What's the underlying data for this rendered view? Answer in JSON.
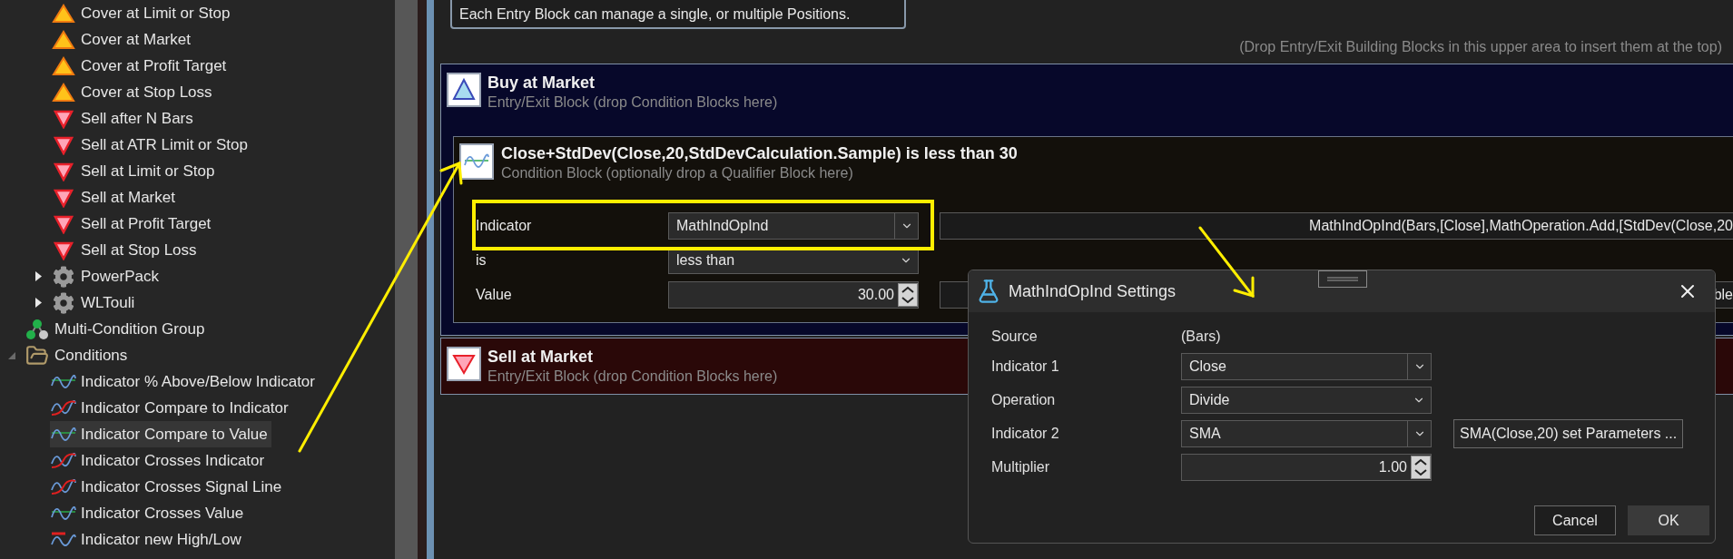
{
  "tree": {
    "continued_children": [
      {
        "label": "Cover at Limit or Stop",
        "kind": "cover",
        "selected": false
      },
      {
        "label": "Cover at Market",
        "kind": "cover",
        "selected": false
      },
      {
        "label": "Cover at Profit Target",
        "kind": "cover",
        "selected": false
      },
      {
        "label": "Cover at Stop Loss",
        "kind": "cover",
        "selected": false
      },
      {
        "label": "Sell after N Bars",
        "kind": "sell",
        "selected": false
      },
      {
        "label": "Sell at ATR Limit or Stop",
        "kind": "sell",
        "selected": false
      },
      {
        "label": "Sell at Limit or Stop",
        "kind": "sell",
        "selected": false
      },
      {
        "label": "Sell at Market",
        "kind": "sell",
        "selected": false
      },
      {
        "label": "Sell at Profit Target",
        "kind": "sell",
        "selected": false
      },
      {
        "label": "Sell at Stop Loss",
        "kind": "sell",
        "selected": false
      },
      {
        "label": "PowerPack",
        "kind": "gear",
        "selected": false,
        "expanded": false
      },
      {
        "label": "WLTouli",
        "kind": "gear",
        "selected": false,
        "expanded": false
      }
    ],
    "items": [
      {
        "label": "Multi-Condition Group",
        "kind": "group",
        "selected": false
      },
      {
        "label": "Conditions",
        "kind": "folder",
        "selected": false,
        "expanded": true,
        "children": [
          {
            "label": "Indicator % Above/Below Indicator",
            "kind": "wave",
            "selected": false
          },
          {
            "label": "Indicator Compare to Indicator",
            "kind": "cross",
            "selected": false
          },
          {
            "label": "Indicator Compare to Value",
            "kind": "wave",
            "selected": true
          },
          {
            "label": "Indicator Crosses Indicator",
            "kind": "cross",
            "selected": false
          },
          {
            "label": "Indicator Crosses Signal Line",
            "kind": "cross",
            "selected": false
          },
          {
            "label": "Indicator Crosses Value",
            "kind": "wave",
            "selected": false
          },
          {
            "label": "Indicator new High/Low",
            "kind": "newhighlow",
            "selected": false
          }
        ]
      }
    ]
  },
  "info_box": "Each Entry Block can manage a single, or multiple Positions.",
  "drop_hint": "(Drop Entry/Exit Building Blocks in this upper area to insert them at the top)",
  "blocks": [
    {
      "kind": "buy",
      "title": "Buy at Market",
      "subtitle": "Entry/Exit Block (drop Condition Blocks here)",
      "conditions": [
        {
          "title": "Close+StdDev(Close,20,StdDevCalculation.Sample) is less than 30",
          "subtitle": "Condition Block (optionally drop a Qualifier Block here)",
          "params": [
            {
              "label": "Indicator",
              "kind": "combo",
              "value": "MathIndOpInd",
              "extra": "MathIndOpInd(Bars,[Close],MathOperation.Add,[StdDev(Close,20"
            },
            {
              "label": "is",
              "kind": "select",
              "value": "less than"
            },
            {
              "label": "Value",
              "kind": "spinner",
              "value": "30.00",
              "extra": "ble"
            }
          ]
        }
      ]
    },
    {
      "kind": "sell",
      "title": "Sell at Market",
      "subtitle": "Entry/Exit Block (drop Condition Blocks here)"
    }
  ],
  "dialog": {
    "title": "MathIndOpInd Settings",
    "rows": [
      {
        "label": "Source",
        "kind": "text",
        "value": "(Bars)"
      },
      {
        "label": "Indicator 1",
        "kind": "combo",
        "value": "Close"
      },
      {
        "label": "Operation",
        "kind": "select",
        "value": "Divide"
      },
      {
        "label": "Indicator 2",
        "kind": "combo",
        "value": "SMA",
        "button": "SMA(Close,20) set Parameters ..."
      },
      {
        "label": "Multiplier",
        "kind": "spinner",
        "value": "1.00"
      }
    ],
    "buttons": [
      {
        "label": "Cancel",
        "default": false
      },
      {
        "label": "OK",
        "default": true
      }
    ]
  }
}
